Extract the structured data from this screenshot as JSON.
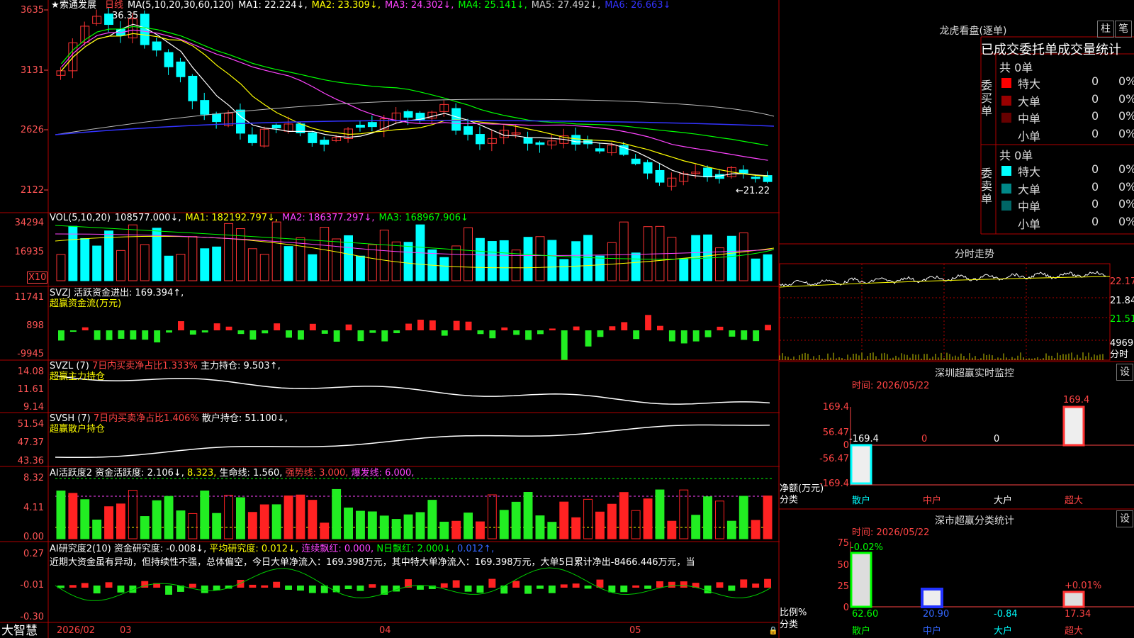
{
  "stock": {
    "star": "★",
    "name": "索通发展",
    "period": "日线",
    "hi_label": "36.35",
    "lo_label": "←21.22"
  },
  "ma_line": [
    {
      "t": "MA(5,10,20,30,60,120)",
      "c": "#ffffff"
    },
    {
      "t": "MA1: 22.224↓,",
      "c": "#ffffff"
    },
    {
      "t": "MA2: 23.309↓,",
      "c": "#ffff00"
    },
    {
      "t": "MA3: 24.302↓,",
      "c": "#ff44ff"
    },
    {
      "t": "MA4: 25.141↓,",
      "c": "#00ff00"
    },
    {
      "t": "MA5: 27.492↓,",
      "c": "#cccccc"
    },
    {
      "t": "MA6: 26.663↓",
      "c": "#3333ff"
    }
  ],
  "price_axis": [
    "3635",
    "3131",
    "2626",
    "2122"
  ],
  "vol_line": [
    {
      "t": "VOL(5,10,20)",
      "c": "#ffffff"
    },
    {
      "t": "108577.000↓,",
      "c": "#ffffff"
    },
    {
      "t": "MA1: 182192.797↓,",
      "c": "#ffff00"
    },
    {
      "t": "MA2: 186377.297↓,",
      "c": "#ff44ff"
    },
    {
      "t": "MA3: 168967.906↓",
      "c": "#00ff00"
    }
  ],
  "vol_axis": [
    "34294",
    "16935"
  ],
  "vol_unit": "X10",
  "svzj": {
    "line1": "SVZJ  活跃资金进出: 169.394↑,",
    "line2": "超赢资金流(万元)",
    "axis": [
      "11741",
      "898",
      "-9945"
    ]
  },
  "svzl": {
    "a": "SVZL (7)",
    "b": "7日内买卖净占比1.333%",
    "c": "主力持仓: 9.503↑,",
    "line2": "超赢主力持仓",
    "axis": [
      "14.08",
      "11.61",
      "9.14"
    ]
  },
  "svsh": {
    "a": "SVSH (7)",
    "b": "7日内买卖净占比1.406%",
    "c": "散户持仓: 51.100↓,",
    "line2": "超赢散户持仓",
    "axis": [
      "51.54",
      "47.37",
      "43.36"
    ]
  },
  "ai1": {
    "a": "AI活跃度2",
    "b": "资金活跃度: 2.106↓,",
    "c": "8.323,",
    "d": "生命线: 1.560,",
    "e": "强势线: 3.000,",
    "f": "爆发线: 6.000,",
    "axis": [
      "8.32",
      "4.11",
      "0.00"
    ]
  },
  "ai2": {
    "a": "AI研究度2(10)",
    "b": "资金研究度: -0.008↓,",
    "c": "平均研究度: 0.012↓,",
    "d": "连续飘红: 0.000,",
    "e": "N日飘红: 2.000↓,",
    "f": "0.012↑,",
    "text": "近期大资金虽有异动，但持续性不强，总体偏空，今日大单净流入：169.398万元，其中特大单净流入：169.398万元，大单5日累计净出-8466.446万元，当",
    "axis": [
      "0.27",
      "-0.01",
      "-0.30"
    ]
  },
  "bottom": {
    "brand": "大智慧",
    "date": "2026/02",
    "m1": "03",
    "m2": "04",
    "m3": "05"
  },
  "lhb": {
    "title": "龙虎看盘(逐单)",
    "btn1": "柱",
    "btn2": "笔",
    "head": "已成交委托单成交量统计",
    "buy_total": "共 0单",
    "sell_total": "共 0单",
    "buy_label": "委买单",
    "sell_label": "委卖单",
    "buy_rows": [
      {
        "n": "特大",
        "v": "0",
        "p": "0%",
        "c": "#ff0000"
      },
      {
        "n": "大单",
        "v": "0",
        "p": "0%",
        "c": "#990000"
      },
      {
        "n": "中单",
        "v": "0",
        "p": "0%",
        "c": "#660000"
      },
      {
        "n": "小单",
        "v": "0",
        "p": "0%",
        "c": ""
      }
    ],
    "sell_rows": [
      {
        "n": "特大",
        "v": "0",
        "p": "0%",
        "c": "#00ffff"
      },
      {
        "n": "大单",
        "v": "0",
        "p": "0%",
        "c": "#008888"
      },
      {
        "n": "中单",
        "v": "0",
        "p": "0%",
        "c": "#006666"
      },
      {
        "n": "小单",
        "v": "0",
        "p": "0%",
        "c": ""
      }
    ]
  },
  "fenshi": {
    "title": "分时走势",
    "p1": "22.17",
    "p2": "21.84",
    "p3": "21.51",
    "vol": "4969",
    "vol_unit": "分时"
  },
  "monitor": {
    "title": "深圳超赢实时监控",
    "btn": "设",
    "time": "时间: 2026/05/22",
    "axis": [
      "169.4",
      "56.47",
      "0",
      "-56.47",
      "-169.4"
    ],
    "vals": [
      "-169.4",
      "0",
      "0",
      "169.4"
    ],
    "cats": [
      "散户",
      "中户",
      "大户",
      "超大"
    ],
    "ylabel": "净额(万元)",
    "xlabel": "分类"
  },
  "classify": {
    "title": "深市超赢分类统计",
    "btn": "设",
    "time": "时间: 2026/05/22",
    "axis": [
      "75",
      "50",
      "25",
      "0"
    ],
    "tops": [
      "-0.02%",
      "+0.01%"
    ],
    "vals": [
      "62.60",
      "20.90",
      "-0.84",
      "17.34"
    ],
    "cats": [
      "散户",
      "中户",
      "大户",
      "超大"
    ],
    "ylabel": "比例%",
    "xlabel": "分类"
  }
}
